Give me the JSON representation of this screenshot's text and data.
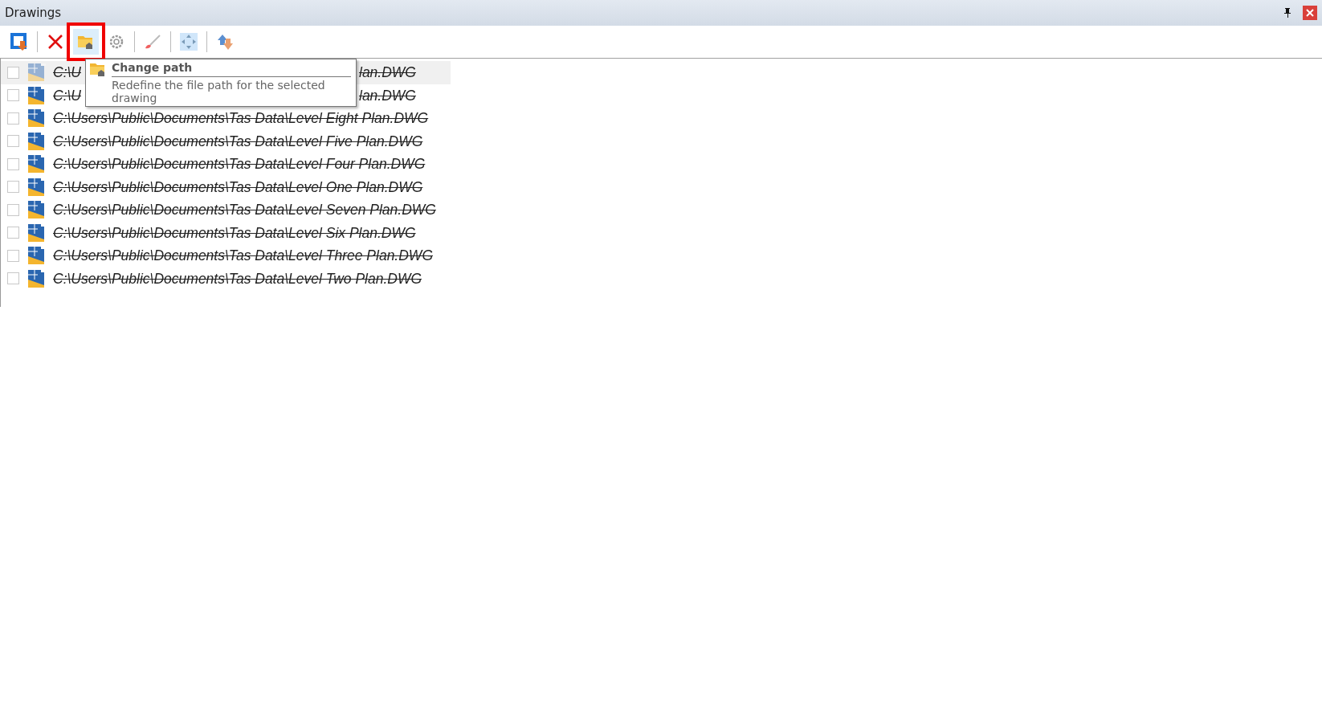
{
  "window": {
    "title": "Drawings"
  },
  "toolbar": [
    {
      "kind": "add",
      "hovered": false
    },
    {
      "kind": "sep"
    },
    {
      "kind": "delete",
      "hovered": false
    },
    {
      "kind": "path",
      "hovered": true
    },
    {
      "kind": "settings",
      "hovered": false
    },
    {
      "kind": "sep"
    },
    {
      "kind": "brush",
      "hovered": false
    },
    {
      "kind": "sep"
    },
    {
      "kind": "move",
      "hovered": false
    },
    {
      "kind": "sep"
    },
    {
      "kind": "swap",
      "hovered": false
    }
  ],
  "tooltip": {
    "title": "Change path",
    "text": "Redefine the file path for the selected drawing"
  },
  "drawings": [
    {
      "path": "C:\\U",
      "path_end": "lan.DWG",
      "checked": false,
      "selected": true
    },
    {
      "path": "C:\\U",
      "path_end": "lan.DWG",
      "checked": false,
      "selected": false
    },
    {
      "path": "C:\\Users\\Public\\Documents\\Tas Data\\Level Eight Plan.DWG",
      "checked": false,
      "selected": false
    },
    {
      "path": "C:\\Users\\Public\\Documents\\Tas Data\\Level Five Plan.DWG",
      "checked": false,
      "selected": false
    },
    {
      "path": "C:\\Users\\Public\\Documents\\Tas Data\\Level Four Plan.DWG",
      "checked": false,
      "selected": false
    },
    {
      "path": "C:\\Users\\Public\\Documents\\Tas Data\\Level One Plan.DWG",
      "checked": false,
      "selected": false
    },
    {
      "path": "C:\\Users\\Public\\Documents\\Tas Data\\Level Seven Plan.DWG",
      "checked": false,
      "selected": false
    },
    {
      "path": "C:\\Users\\Public\\Documents\\Tas Data\\Level Six Plan.DWG",
      "checked": false,
      "selected": false
    },
    {
      "path": "C:\\Users\\Public\\Documents\\Tas Data\\Level Three Plan.DWG",
      "checked": false,
      "selected": false
    },
    {
      "path": "C:\\Users\\Public\\Documents\\Tas Data\\Level Two Plan.DWG",
      "checked": false,
      "selected": false
    }
  ]
}
